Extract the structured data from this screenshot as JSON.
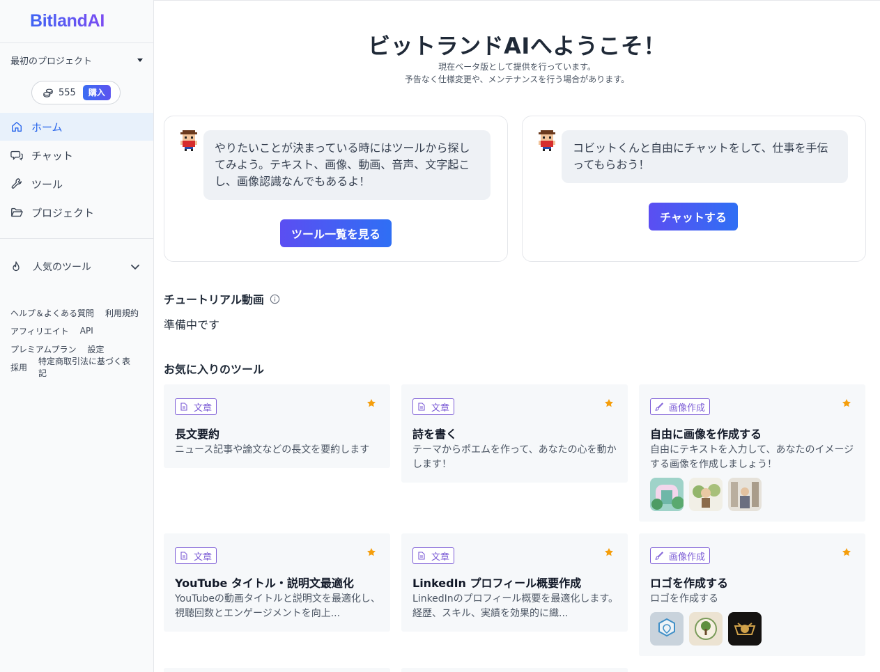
{
  "sidebar": {
    "logo": "BitlandAI",
    "project": "最初のプロジェクト",
    "credits": "555",
    "buy_label": "購入",
    "nav": [
      {
        "label": "ホーム",
        "icon": "home-icon"
      },
      {
        "label": "チャット",
        "icon": "chat-icon"
      },
      {
        "label": "ツール",
        "icon": "wrench-icon"
      },
      {
        "label": "プロジェクト",
        "icon": "folder-icon"
      }
    ],
    "popular_label": "人気のツール",
    "footer": [
      [
        "ヘルプ＆よくある質問",
        "利用規約"
      ],
      [
        "アフィリエイト",
        "API"
      ],
      [
        "プレミアムプラン",
        "設定"
      ],
      [
        "採用",
        "特定商取引法に基づく表記"
      ]
    ]
  },
  "main": {
    "welcome": "ビットランドAIへようこそ！",
    "sub1": "現在ベータ版として提供を行っています。",
    "sub2": "予告なく仕様変更や、メンテナンスを行う場合があります。",
    "card_tools": {
      "line1": "やりたいことが決まっている時にはツールから探し",
      "line2": "てみよう。テキスト、画像、動画、音声、文字起こ",
      "line3": "し、画像認識なんでもあるよ！",
      "button": "ツール一覧を見る"
    },
    "card_chat": {
      "line1": "コビットくんと自由にチャットをして、仕事を手伝",
      "line2": "ってもらおう！",
      "button": "チャットする"
    },
    "tutorial_title": "チュートリアル動画",
    "tutorial_status": "準備中です",
    "favorites_title": "お気に入りのツール",
    "tools": [
      {
        "category": "文章",
        "title": "長文要約",
        "desc": [
          "ニュース記事や論文などの長文を要約します"
        ]
      },
      {
        "category": "文章",
        "title": "詩を書く",
        "desc": [
          "テーマからポエムを作って、あなたの心を動か",
          "します！"
        ]
      },
      {
        "category": "画像作成",
        "title": "自由に画像を作成する",
        "desc": [
          "自由にテキストを入力して、あなたのイメージ",
          "する画像を作成しましょう！"
        ]
      },
      {
        "category": "文章",
        "title": "YouTube タイトル・説明文最適化",
        "desc": [
          "YouTubeの動画タイトルと説明文を最適化し、",
          "視聴回数とエンゲージメントを向上..."
        ]
      },
      {
        "category": "文章",
        "title": "LinkedIn プロフィール概要作成",
        "desc": [
          "LinkedInのプロフィール概要を最適化します。",
          "経歴、スキル、実績を効果的に織..."
        ]
      },
      {
        "category": "画像作成",
        "title": "ロゴを作成する",
        "desc": [
          "ロゴを作成する"
        ]
      }
    ]
  },
  "colors": {
    "accent": "#4f5bf0",
    "active_nav_bg": "#e8f1fb",
    "badge": "#7c5cd6",
    "star": "#f59e0b"
  }
}
